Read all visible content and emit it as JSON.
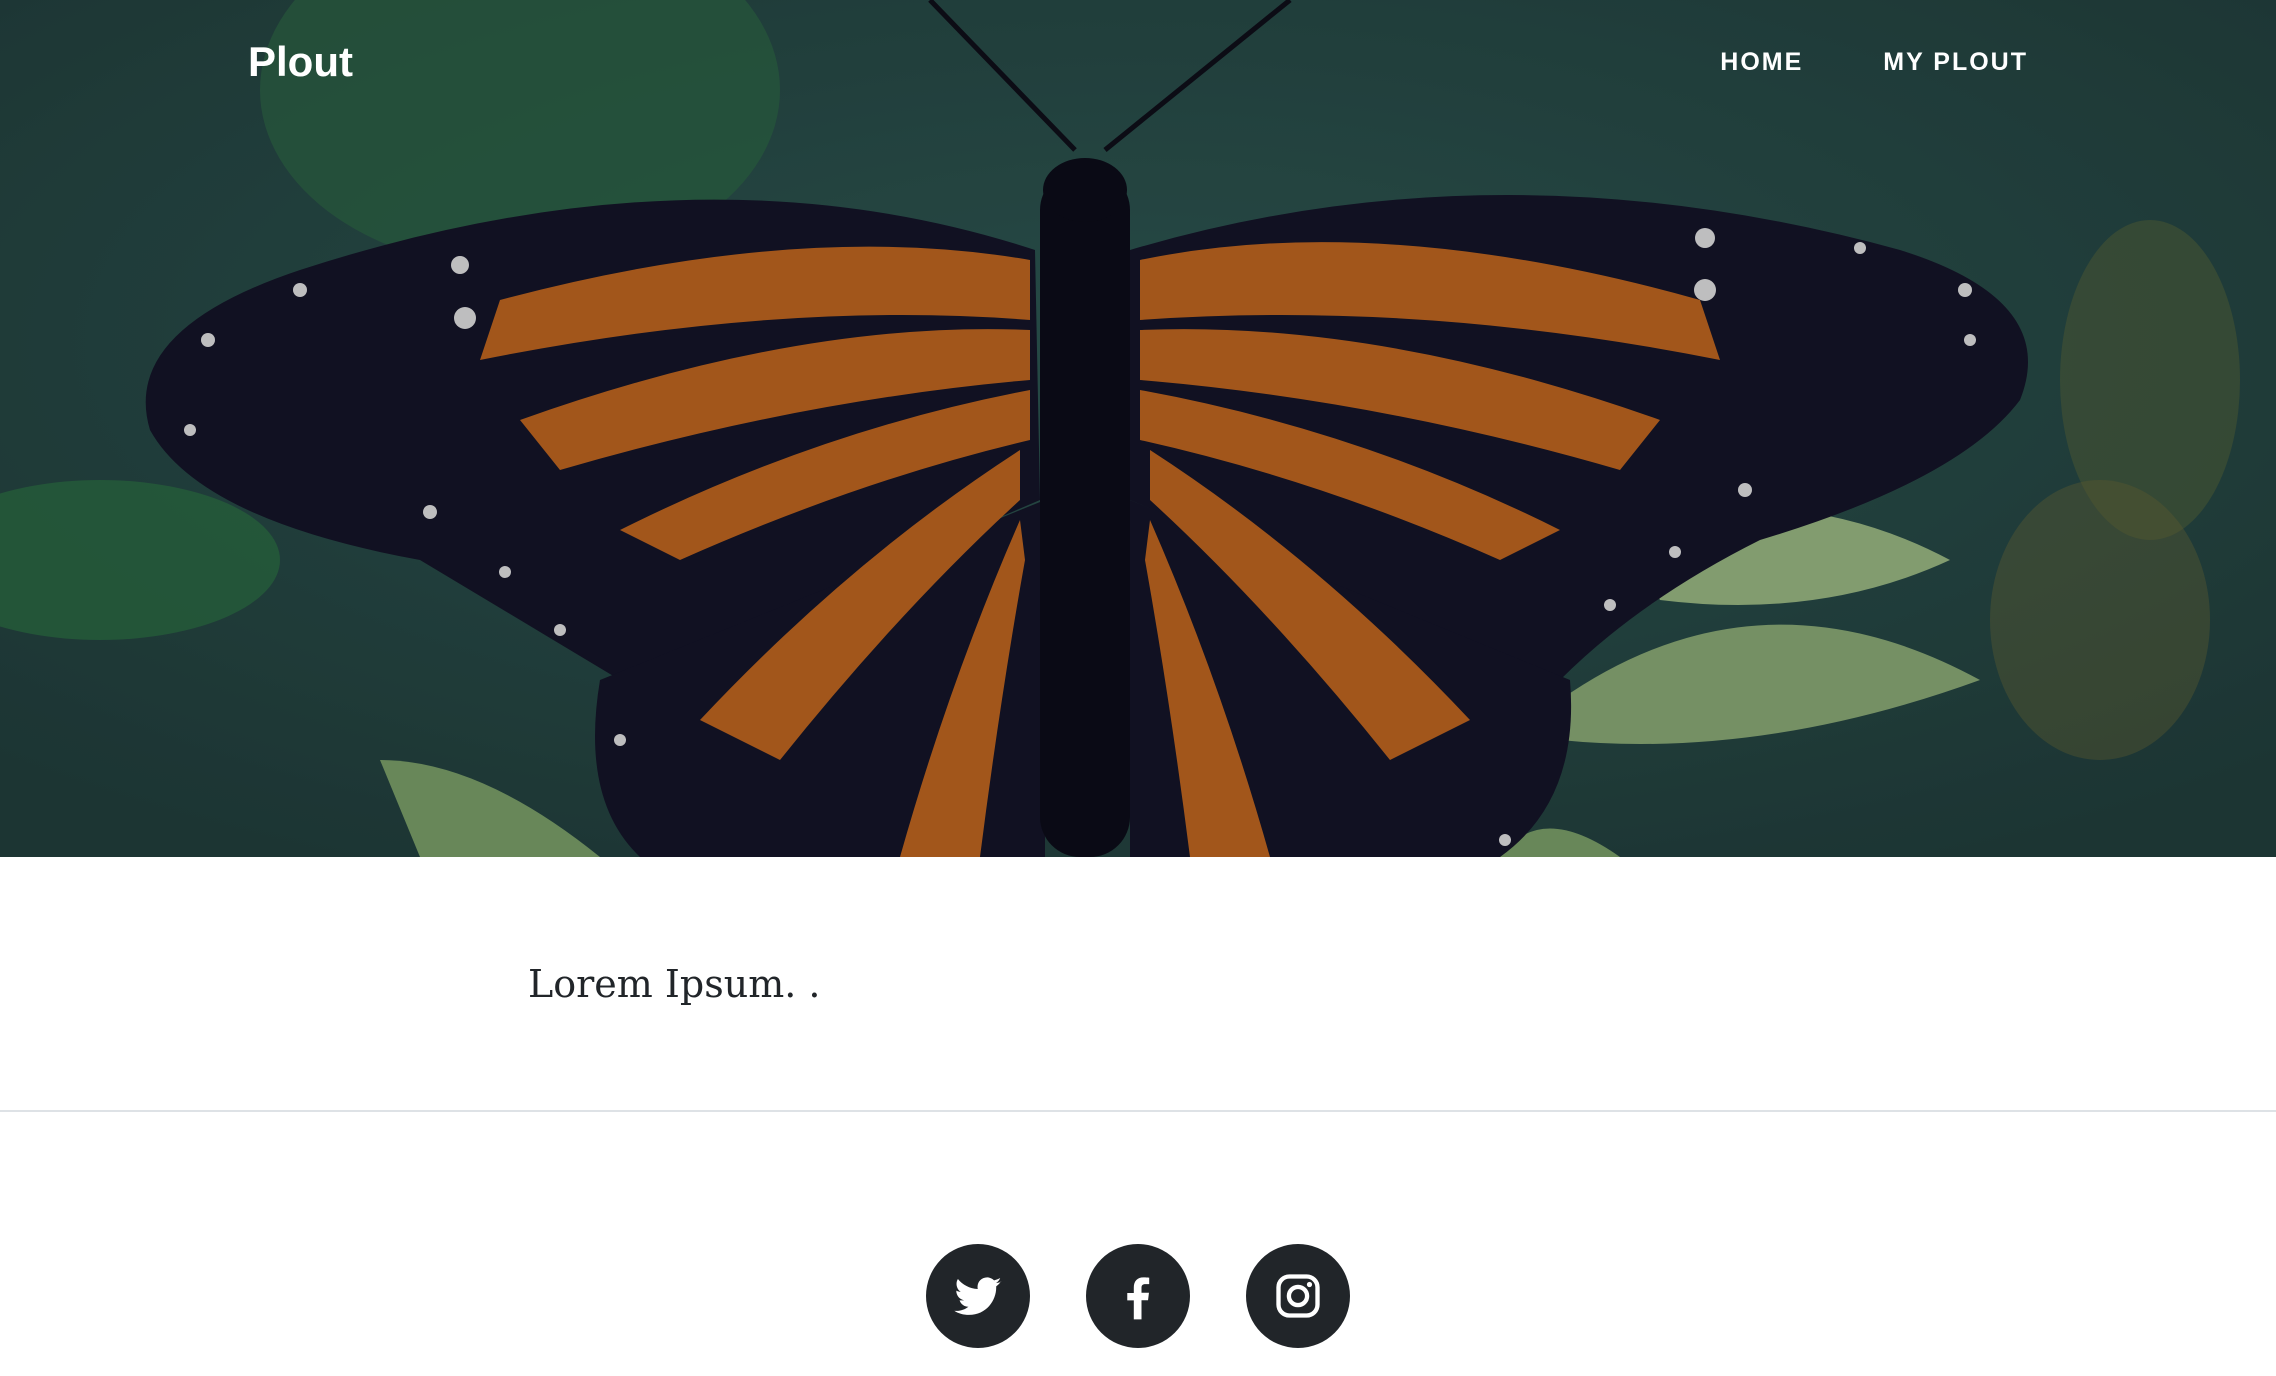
{
  "header": {
    "brand": "Plout",
    "nav": [
      {
        "label": "HOME"
      },
      {
        "label": "MY PLOUT"
      }
    ]
  },
  "hero": {
    "image": "monarch-butterfly-on-leaf"
  },
  "main": {
    "text": "Lorem Ipsum. ."
  },
  "footer": {
    "social": [
      {
        "icon": "twitter-icon"
      },
      {
        "icon": "facebook-icon"
      },
      {
        "icon": "instagram-icon"
      }
    ]
  }
}
